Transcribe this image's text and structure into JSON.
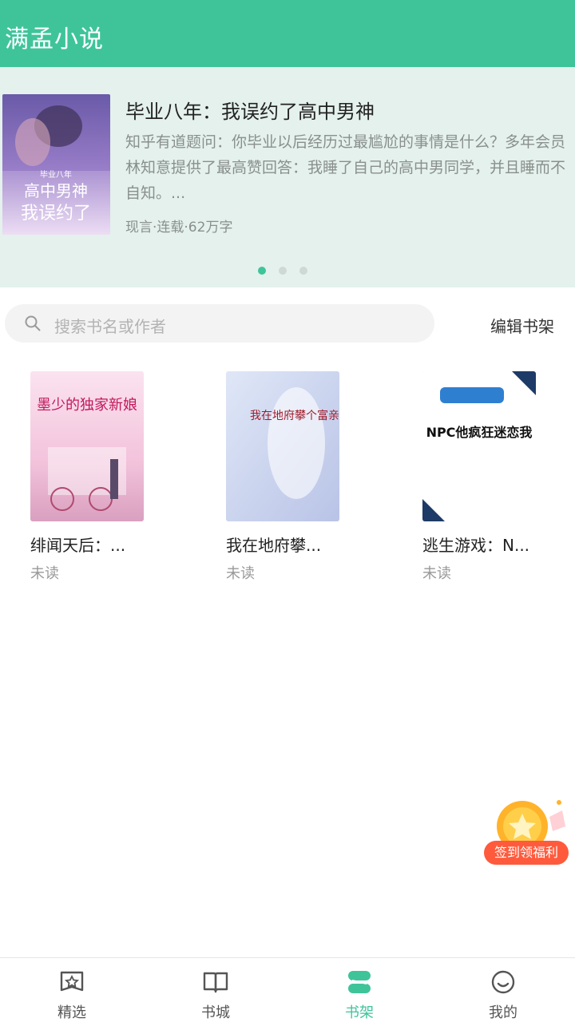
{
  "app": {
    "title": "满孟小说"
  },
  "banner": {
    "title": "毕业八年：我误约了高中男神",
    "description": "知乎有道题问：你毕业以后经历过最尴尬的事情是什么？多年会员林知意提供了最高赞回答：我睡了自己的高中男同学，并且睡而不自知。...",
    "meta": "现言·连载·62万字",
    "cover_text": [
      "毕业八年",
      "高中男神",
      "我误约了"
    ],
    "dots": 3,
    "active_dot": 0
  },
  "search": {
    "placeholder": "搜索书名或作者",
    "icon": "search-icon"
  },
  "shelf": {
    "edit_label": "编辑书架",
    "books": [
      {
        "name": "绯闻天后：...",
        "status": "未读",
        "cover_text": "墨少的独家新娘"
      },
      {
        "name": "我在地府攀...",
        "status": "未读",
        "cover_text": "我在地府攀个富亲"
      },
      {
        "name": "逃生游戏：N...",
        "status": "未读",
        "cover_text": "NPC他疯狂迷恋我"
      }
    ]
  },
  "float_gift": {
    "label": "签到领福利"
  },
  "tabbar": {
    "items": [
      {
        "label": "精选",
        "icon": "star-badge-icon"
      },
      {
        "label": "书城",
        "icon": "open-book-icon"
      },
      {
        "label": "书架",
        "icon": "bookshelf-icon"
      },
      {
        "label": "我的",
        "icon": "smile-face-icon"
      }
    ],
    "active_index": 2
  },
  "colors": {
    "accent": "#3fc49a",
    "banner_bg": "#e4f1ec",
    "gift": "#ff5a3c"
  }
}
